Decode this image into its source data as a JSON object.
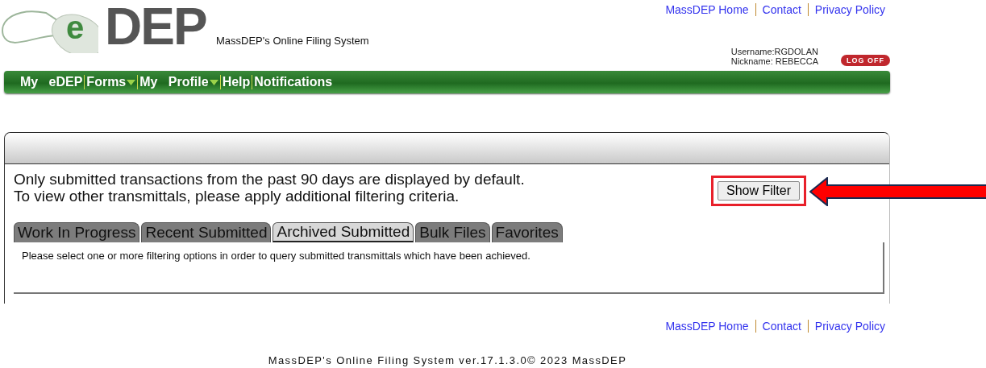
{
  "logo": {
    "letter": "e",
    "word": "DEP",
    "tagline": "MassDEP's Online Filing System"
  },
  "top_links": [
    "MassDEP Home",
    "Contact",
    "Privacy Policy"
  ],
  "user": {
    "username": "Username:RGDOLAN",
    "nickname": "Nickname: REBECCA",
    "logoff": "LOG OFF"
  },
  "nav": [
    {
      "label": "My   eDEP",
      "has_menu": false
    },
    {
      "label": "Forms",
      "has_menu": true
    },
    {
      "label": "My   Profile",
      "has_menu": true
    },
    {
      "label": "Help",
      "has_menu": false
    },
    {
      "label": "Notifications",
      "has_menu": false
    }
  ],
  "notice": [
    "Only submitted transactions from the past 90 days are displayed by default.",
    "To view other transmittals, please apply additional filtering criteria."
  ],
  "show_filter": "Show Filter",
  "tabs": [
    {
      "label": "Work In Progress",
      "selected": false
    },
    {
      "label": "Recent Submitted",
      "selected": false
    },
    {
      "label": "Archived Submitted",
      "selected": true
    },
    {
      "label": "Bulk Files",
      "selected": false
    },
    {
      "label": "Favorites",
      "selected": false
    }
  ],
  "tab_message": "Please select one or more filtering options in order to query submitted transmittals which have been achieved.",
  "footer_links": [
    "MassDEP Home",
    "Contact",
    "Privacy Policy"
  ],
  "copyright": "MassDEP's Online Filing System ver.17.1.3.0© 2023 MassDEP"
}
